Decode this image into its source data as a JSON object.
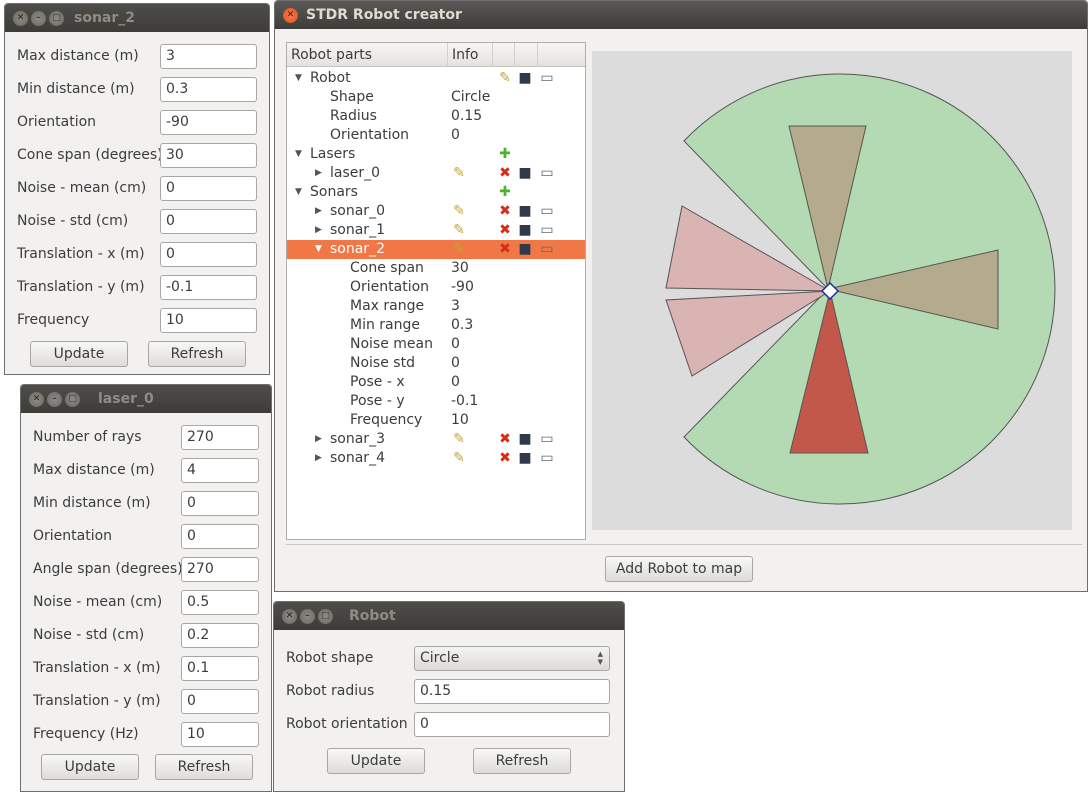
{
  "sonar_window": {
    "title": "sonar_2",
    "fields": [
      {
        "label": "Max distance (m)",
        "value": "3"
      },
      {
        "label": "Min distance (m)",
        "value": "0.3"
      },
      {
        "label": "Orientation",
        "value": "-90"
      },
      {
        "label": "Cone span (degrees)",
        "value": "30"
      },
      {
        "label": "Noise - mean (cm)",
        "value": "0"
      },
      {
        "label": "Noise - std (cm)",
        "value": "0"
      },
      {
        "label": "Translation - x (m)",
        "value": "0"
      },
      {
        "label": "Translation - y (m)",
        "value": "-0.1"
      },
      {
        "label": "Frequency",
        "value": "10"
      }
    ],
    "update_label": "Update",
    "refresh_label": "Refresh"
  },
  "laser_window": {
    "title": "laser_0",
    "fields": [
      {
        "label": "Number of rays",
        "value": "270"
      },
      {
        "label": "Max distance (m)",
        "value": "4"
      },
      {
        "label": "Min distance (m)",
        "value": "0"
      },
      {
        "label": "Orientation",
        "value": "0"
      },
      {
        "label": "Angle span (degrees)",
        "value": "270"
      },
      {
        "label": "Noise - mean (cm)",
        "value": "0.5"
      },
      {
        "label": "Noise - std (cm)",
        "value": "0.2"
      },
      {
        "label": "Translation - x (m)",
        "value": "0.1"
      },
      {
        "label": "Translation - y (m)",
        "value": "0"
      },
      {
        "label": "Frequency (Hz)",
        "value": "10"
      }
    ],
    "update_label": "Update",
    "refresh_label": "Refresh"
  },
  "robot_window": {
    "title": "Robot",
    "shape_label": "Robot shape",
    "shape_value": "Circle",
    "radius_label": "Robot radius",
    "radius_value": "0.15",
    "orientation_label": "Robot orientation",
    "orientation_value": "0",
    "update_label": "Update",
    "refresh_label": "Refresh"
  },
  "main_window": {
    "title": "STDR Robot creator",
    "tree_headers": {
      "parts": "Robot parts",
      "info": "Info"
    },
    "tree": [
      {
        "name": "Robot",
        "info": "",
        "level": 0,
        "twisty": "open",
        "icons": [
          "edit-icon",
          "save-icon",
          "open-folder-icon"
        ]
      },
      {
        "name": "Shape",
        "info": "Circle",
        "level": 1,
        "twisty": "",
        "icons": []
      },
      {
        "name": "Radius",
        "info": "0.15",
        "level": 1,
        "twisty": "",
        "icons": []
      },
      {
        "name": "Orientation",
        "info": "0",
        "level": 1,
        "twisty": "",
        "icons": []
      },
      {
        "name": "Lasers",
        "info": "",
        "level": 0,
        "twisty": "open",
        "icons": [
          "add-icon"
        ]
      },
      {
        "name": "laser_0",
        "info": "",
        "level": 1,
        "twisty": "closed",
        "icons": [
          "edit-icon",
          "delete-icon",
          "save-icon",
          "open-folder-icon"
        ]
      },
      {
        "name": "Sonars",
        "info": "",
        "level": 0,
        "twisty": "open",
        "icons": [
          "add-icon"
        ]
      },
      {
        "name": "sonar_0",
        "info": "",
        "level": 1,
        "twisty": "closed",
        "icons": [
          "edit-icon",
          "delete-icon",
          "save-icon",
          "open-folder-icon"
        ]
      },
      {
        "name": "sonar_1",
        "info": "",
        "level": 1,
        "twisty": "closed",
        "icons": [
          "edit-icon",
          "delete-icon",
          "save-icon",
          "open-folder-icon"
        ]
      },
      {
        "name": "sonar_2",
        "info": "",
        "level": 1,
        "twisty": "open",
        "icons": [
          "edit-icon",
          "delete-icon",
          "save-icon",
          "open-folder-icon"
        ],
        "selected": true
      },
      {
        "name": "Cone span",
        "info": "30",
        "level": 2,
        "twisty": "",
        "icons": []
      },
      {
        "name": "Orientation",
        "info": "-90",
        "level": 2,
        "twisty": "",
        "icons": []
      },
      {
        "name": "Max range",
        "info": "3",
        "level": 2,
        "twisty": "",
        "icons": []
      },
      {
        "name": "Min range",
        "info": "0.3",
        "level": 2,
        "twisty": "",
        "icons": []
      },
      {
        "name": "Noise mean",
        "info": "0",
        "level": 2,
        "twisty": "",
        "icons": []
      },
      {
        "name": "Noise std",
        "info": "0",
        "level": 2,
        "twisty": "",
        "icons": []
      },
      {
        "name": "Pose - x",
        "info": "0",
        "level": 2,
        "twisty": "",
        "icons": []
      },
      {
        "name": "Pose - y",
        "info": "-0.1",
        "level": 2,
        "twisty": "",
        "icons": []
      },
      {
        "name": "Frequency",
        "info": "10",
        "level": 2,
        "twisty": "",
        "icons": []
      },
      {
        "name": "sonar_3",
        "info": "",
        "level": 1,
        "twisty": "closed",
        "icons": [
          "edit-icon",
          "delete-icon",
          "save-icon",
          "open-folder-icon"
        ]
      },
      {
        "name": "sonar_4",
        "info": "",
        "level": 1,
        "twisty": "closed",
        "icons": [
          "edit-icon",
          "delete-icon",
          "save-icon",
          "open-folder-icon"
        ]
      }
    ],
    "add_robot_label": "Add Robot to map",
    "colors": {
      "laser_fill": "#b3dab3",
      "sonar_fill": "#b3ab8c",
      "sonar_other_fill": "#dab3b3",
      "sonar_selected_fill": "#c1584a",
      "selection": "#f07746",
      "canvas_bg": "#dcdcdc"
    }
  }
}
